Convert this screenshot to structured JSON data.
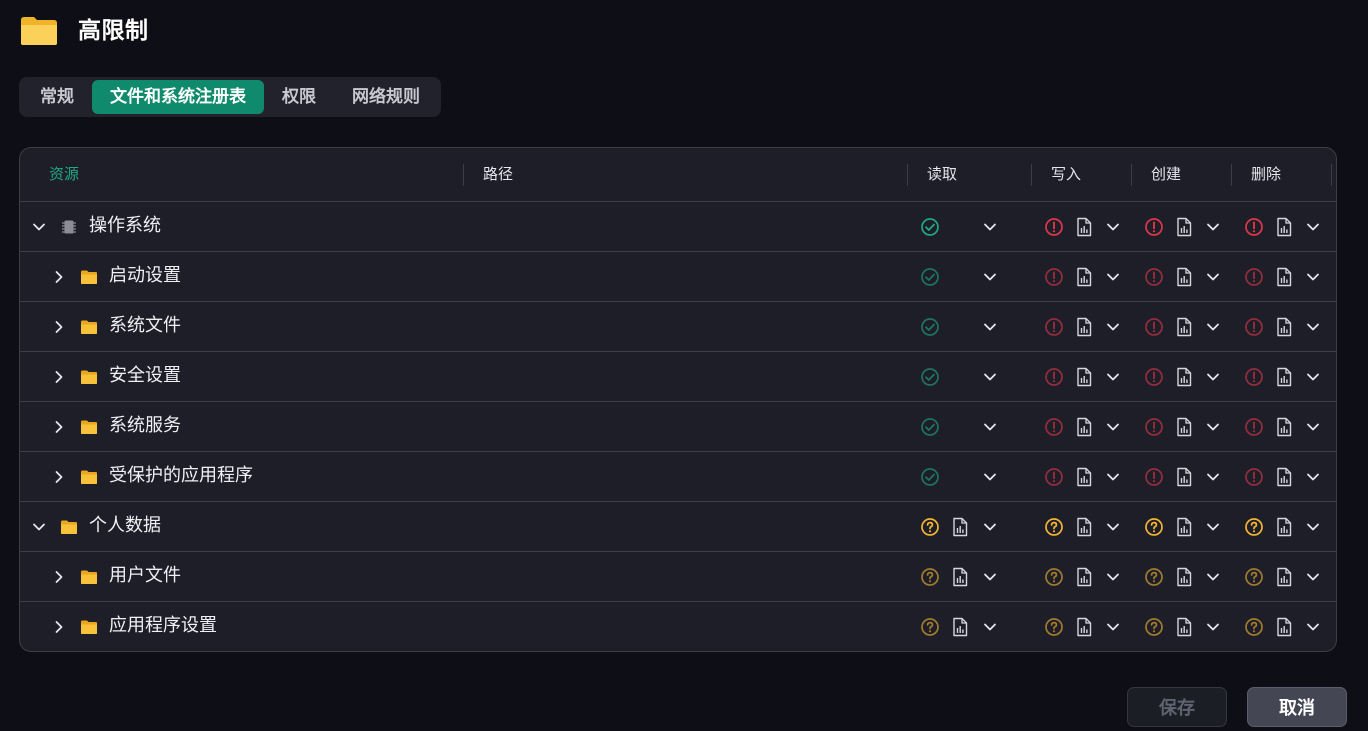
{
  "title": "高限制",
  "tabs": [
    {
      "label": "常规",
      "active": false
    },
    {
      "label": "文件和系统注册表",
      "active": true
    },
    {
      "label": "权限",
      "active": false
    },
    {
      "label": "网络规则",
      "active": false
    }
  ],
  "columns": {
    "resource": "资源",
    "path": "路径",
    "read": "读取",
    "write": "写入",
    "create": "创建",
    "delete": "删除"
  },
  "rows": [
    {
      "label": "操作系统",
      "level": 0,
      "expanded": true,
      "icon": "chip-icon",
      "read": "allow",
      "write": "deny",
      "create": "deny",
      "delete": "deny"
    },
    {
      "label": "启动设置",
      "level": 1,
      "expanded": false,
      "icon": "folder-icon",
      "read": "allow",
      "write": "deny",
      "create": "deny",
      "delete": "deny"
    },
    {
      "label": "系统文件",
      "level": 1,
      "expanded": false,
      "icon": "folder-icon",
      "read": "allow",
      "write": "deny",
      "create": "deny",
      "delete": "deny"
    },
    {
      "label": "安全设置",
      "level": 1,
      "expanded": false,
      "icon": "folder-icon",
      "read": "allow",
      "write": "deny",
      "create": "deny",
      "delete": "deny"
    },
    {
      "label": "系统服务",
      "level": 1,
      "expanded": false,
      "icon": "folder-icon",
      "read": "allow",
      "write": "deny",
      "create": "deny",
      "delete": "deny"
    },
    {
      "label": "受保护的应用程序",
      "level": 1,
      "expanded": false,
      "icon": "folder-icon",
      "read": "allow",
      "write": "deny",
      "create": "deny",
      "delete": "deny"
    },
    {
      "label": "个人数据",
      "level": 0,
      "expanded": true,
      "icon": "folder-icon",
      "read": "ask",
      "write": "ask",
      "create": "ask",
      "delete": "ask"
    },
    {
      "label": "用户文件",
      "level": 1,
      "expanded": false,
      "icon": "folder-icon",
      "read": "ask",
      "write": "ask",
      "create": "ask",
      "delete": "ask"
    },
    {
      "label": "应用程序设置",
      "level": 1,
      "expanded": false,
      "icon": "folder-icon",
      "read": "ask",
      "write": "ask",
      "create": "ask",
      "delete": "ask"
    }
  ],
  "buttons": {
    "save": "保存",
    "cancel": "取消"
  },
  "colors": {
    "accent": "#0f8a6c",
    "allow": "#1fa884",
    "deny": "#e0374a",
    "ask": "#f2b431",
    "folder": "#f7c23a"
  }
}
